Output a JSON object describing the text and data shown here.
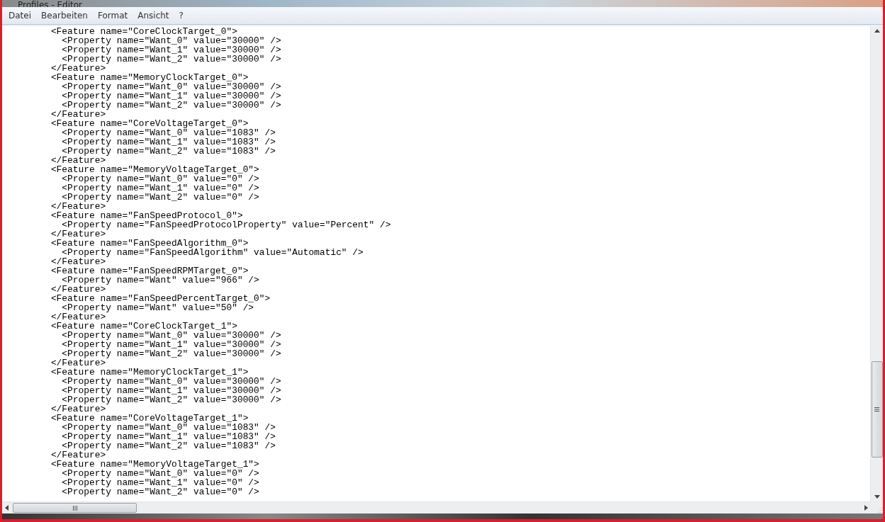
{
  "window": {
    "title": "Profiles - Editor"
  },
  "menu": [
    "Datei",
    "Bearbeiten",
    "Format",
    "Ansicht",
    "?"
  ],
  "lines": [
    "        <Feature name=\"CoreClockTarget_0\">",
    "          <Property name=\"Want_0\" value=\"30000\" />",
    "          <Property name=\"Want_1\" value=\"30000\" />",
    "          <Property name=\"Want_2\" value=\"30000\" />",
    "        </Feature>",
    "        <Feature name=\"MemoryClockTarget_0\">",
    "          <Property name=\"Want_0\" value=\"30000\" />",
    "          <Property name=\"Want_1\" value=\"30000\" />",
    "          <Property name=\"Want_2\" value=\"30000\" />",
    "        </Feature>",
    "        <Feature name=\"CoreVoltageTarget_0\">",
    "          <Property name=\"Want_0\" value=\"1083\" />",
    "          <Property name=\"Want_1\" value=\"1083\" />",
    "          <Property name=\"Want_2\" value=\"1083\" />",
    "        </Feature>",
    "        <Feature name=\"MemoryVoltageTarget_0\">",
    "          <Property name=\"Want_0\" value=\"0\" />",
    "          <Property name=\"Want_1\" value=\"0\" />",
    "          <Property name=\"Want_2\" value=\"0\" />",
    "        </Feature>",
    "        <Feature name=\"FanSpeedProtocol_0\">",
    "          <Property name=\"FanSpeedProtocolProperty\" value=\"Percent\" />",
    "        </Feature>",
    "        <Feature name=\"FanSpeedAlgorithm_0\">",
    "          <Property name=\"FanSpeedAlgorithm\" value=\"Automatic\" />",
    "        </Feature>",
    "        <Feature name=\"FanSpeedRPMTarget_0\">",
    "          <Property name=\"Want\" value=\"966\" />",
    "        </Feature>",
    "        <Feature name=\"FanSpeedPercentTarget_0\">",
    "          <Property name=\"Want\" value=\"50\" />",
    "        </Feature>",
    "        <Feature name=\"CoreClockTarget_1\">",
    "          <Property name=\"Want_0\" value=\"30000\" />",
    "          <Property name=\"Want_1\" value=\"30000\" />",
    "          <Property name=\"Want_2\" value=\"30000\" />",
    "        </Feature>",
    "        <Feature name=\"MemoryClockTarget_1\">",
    "          <Property name=\"Want_0\" value=\"30000\" />",
    "          <Property name=\"Want_1\" value=\"30000\" />",
    "          <Property name=\"Want_2\" value=\"30000\" />",
    "        </Feature>",
    "        <Feature name=\"CoreVoltageTarget_1\">",
    "          <Property name=\"Want_0\" value=\"1083\" />",
    "          <Property name=\"Want_1\" value=\"1083\" />",
    "          <Property name=\"Want_2\" value=\"1083\" />",
    "        </Feature>",
    "        <Feature name=\"MemoryVoltageTarget_1\">",
    "          <Property name=\"Want_0\" value=\"0\" />",
    "          <Property name=\"Want_1\" value=\"0\" />",
    "          <Property name=\"Want_2\" value=\"0\" />"
  ]
}
